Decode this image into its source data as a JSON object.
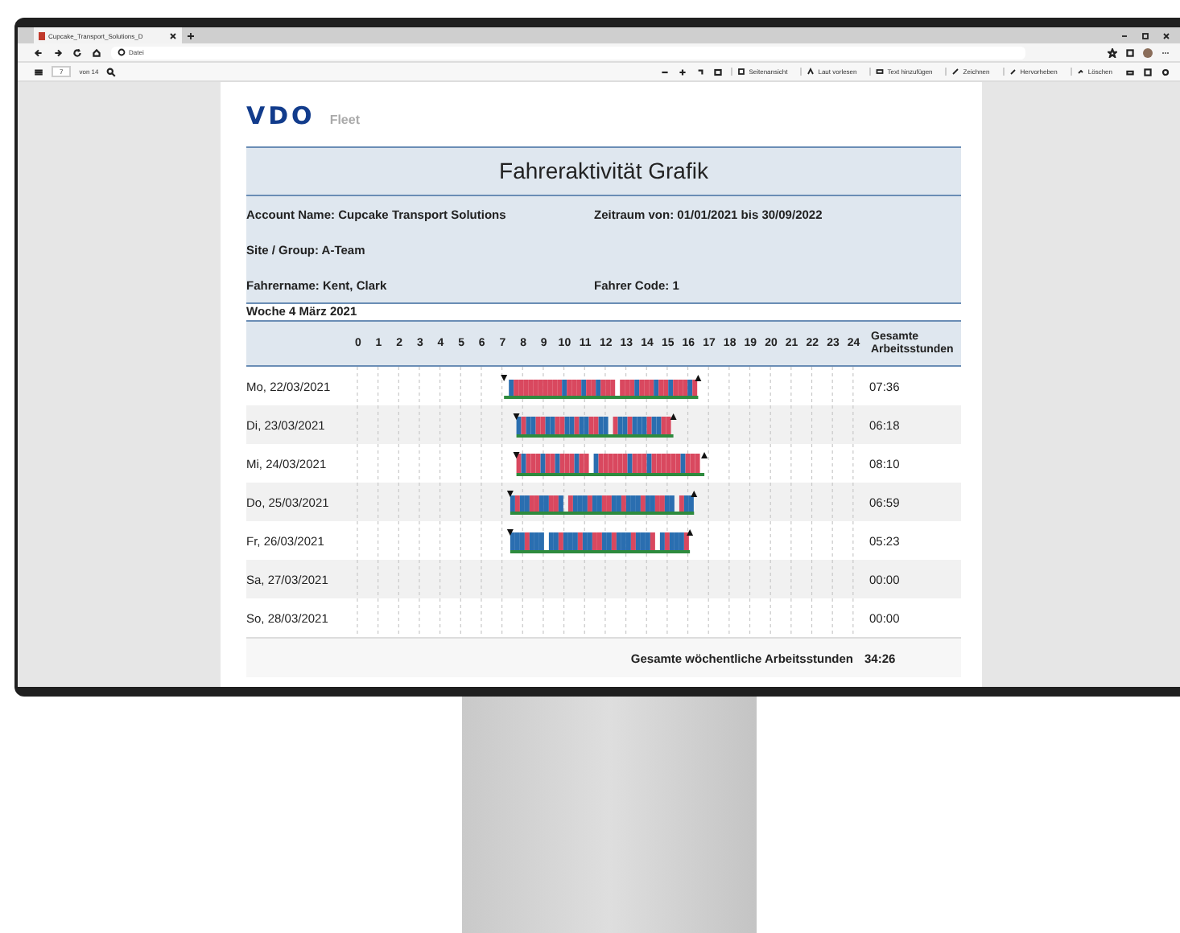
{
  "browser": {
    "tab": {
      "title": "Cupcake_Transport_Solutions_D",
      "selected": true
    },
    "address": "Datei",
    "page": "7",
    "page_count": "von 14",
    "tools": [
      {
        "label": "Seitenansicht"
      },
      {
        "label": "Laut vorlesen"
      },
      {
        "label": "Text hinzufügen"
      },
      {
        "label": "Zeichnen"
      },
      {
        "label": "Hervorheben"
      },
      {
        "label": "Löschen"
      }
    ]
  },
  "report": {
    "logo": "VDO",
    "logo_sub": "Fleet",
    "title": "Fahreraktivität Grafik",
    "info": [
      [
        "Account Name: Cupcake Transport Solutions",
        "Zeitraum von: 01/01/2021 bis 30/09/2022"
      ],
      [
        "Site / Group: A-Team"
      ],
      [
        "Fahrername: Kent, Clark",
        "Fahrer Code: 1"
      ]
    ],
    "week": "Woche 4  März 2021",
    "hours": [
      "0",
      "1",
      "2",
      "3",
      "4",
      "5",
      "6",
      "7",
      "8",
      "9",
      "10",
      "11",
      "12",
      "13",
      "14",
      "15",
      "16",
      "17",
      "18",
      "19",
      "20",
      "21",
      "22",
      "23",
      "24"
    ],
    "total_heading": "Gesamte Arbeitsstunden",
    "rows": [
      {
        "day": "Mo, 22/03/2021",
        "total": "07:36",
        "activity": true
      },
      {
        "day": "Di, 23/03/2021",
        "total": "06:18",
        "activity": true
      },
      {
        "day": "Mi, 24/03/2021",
        "total": "08:10",
        "activity": true
      },
      {
        "day": "Do, 25/03/2021",
        "total": "06:59",
        "activity": true
      },
      {
        "day": "Fr, 26/03/2021",
        "total": "05:23",
        "activity": true
      },
      {
        "day": "Sa, 27/03/2021",
        "total": "00:00",
        "activity": false
      },
      {
        "day": "So, 28/03/2021",
        "total": "00:00",
        "activity": false
      }
    ],
    "weekly_total_label": "Gesamte wöchentliche Arbeitsstunden",
    "weekly_total": "34:26"
  }
}
